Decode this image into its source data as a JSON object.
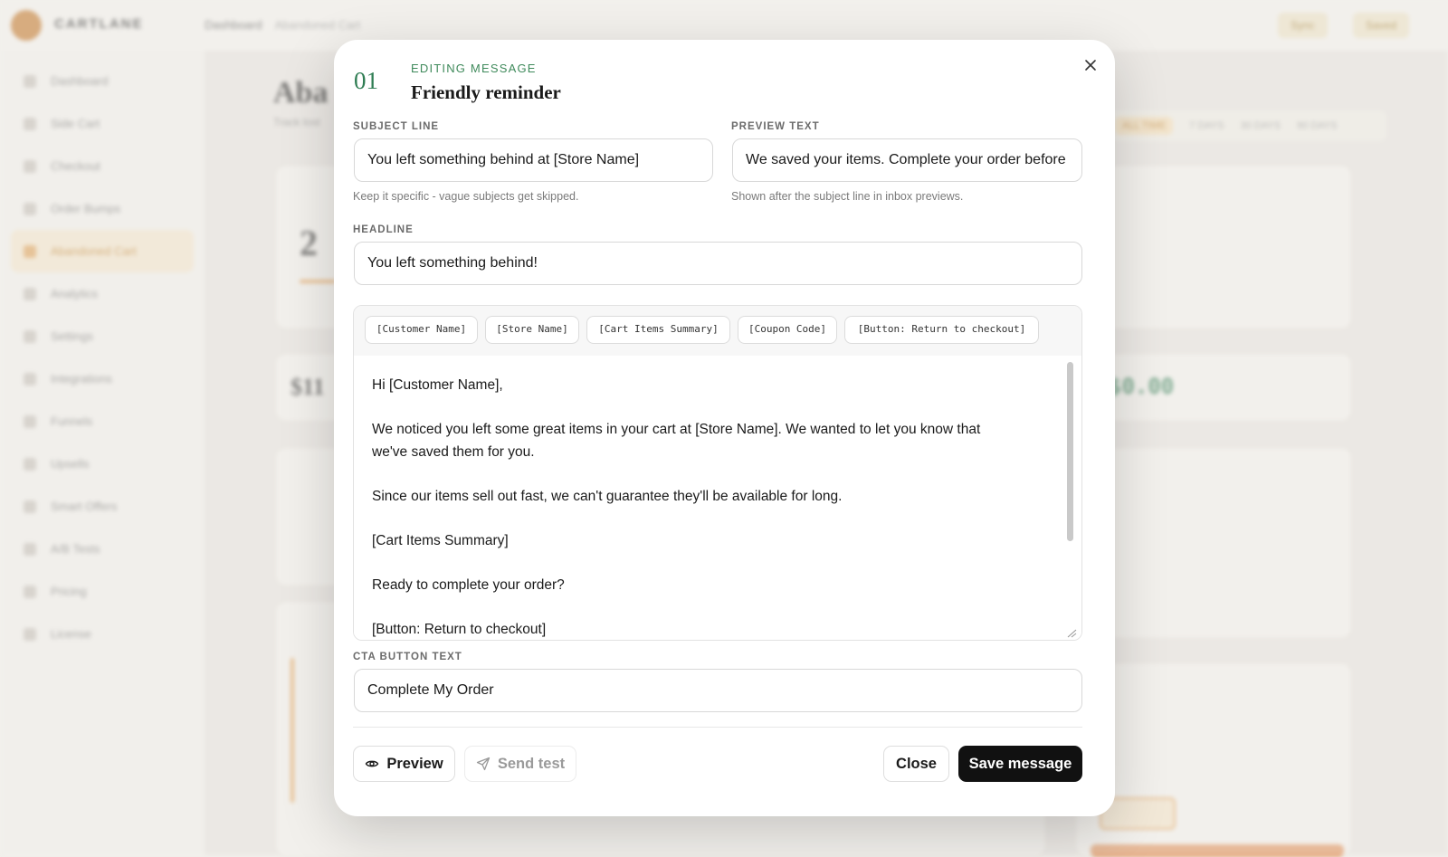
{
  "app": {
    "brand": "CARTLANE",
    "breadcrumb": [
      "Dashboard",
      "Abandoned Cart"
    ],
    "top_buttons": [
      "Sync",
      "Saved"
    ],
    "sidebar": [
      "Dashboard",
      "Side Cart",
      "Checkout",
      "Order Bumps",
      "Abandoned Cart",
      "Analytics",
      "Settings",
      "Integrations",
      "Funnels",
      "Upsells",
      "Smart Offers",
      "A/B Tests",
      "Pricing",
      "License"
    ],
    "page_title": "Aba",
    "page_subtitle": "Track lost",
    "range_tabs": [
      "ALL TIME",
      "7 DAYS",
      "30 DAYS",
      "90 DAYS"
    ],
    "stat_values": [
      "2",
      "$11",
      "$0.00"
    ]
  },
  "modal": {
    "number": "01",
    "eyebrow": "EDITING MESSAGE",
    "title": "Friendly reminder",
    "subject": {
      "label": "SUBJECT LINE",
      "value": "You left something behind at [Store Name]",
      "hint": "Keep it specific - vague subjects get skipped."
    },
    "preview": {
      "label": "PREVIEW TEXT",
      "value": "We saved your items. Complete your order before they're gone.",
      "hint": "Shown after the subject line in inbox previews."
    },
    "headline": {
      "label": "HEADLINE",
      "value": "You left something behind!"
    },
    "merge_tags": [
      "[Customer Name]",
      "[Store Name]",
      "[Cart Items Summary]",
      "[Coupon Code]",
      "[Button: Return to checkout]"
    ],
    "body": "Hi [Customer Name],\n\nWe noticed you left some great items in your cart at [Store Name]. We wanted to let you know that\nwe've saved them for you.\n\nSince our items sell out fast, we can't guarantee they'll be available for long.\n\n[Cart Items Summary]\n\nReady to complete your order?\n\n[Button: Return to checkout]",
    "cta": {
      "label": "CTA BUTTON TEXT",
      "value": "Complete My Order"
    },
    "buttons": {
      "preview": "Preview",
      "send_test": "Send test",
      "close": "Close",
      "save": "Save message"
    },
    "colors": {
      "accent": "#2f7d53",
      "primary_button": "#111111"
    }
  }
}
